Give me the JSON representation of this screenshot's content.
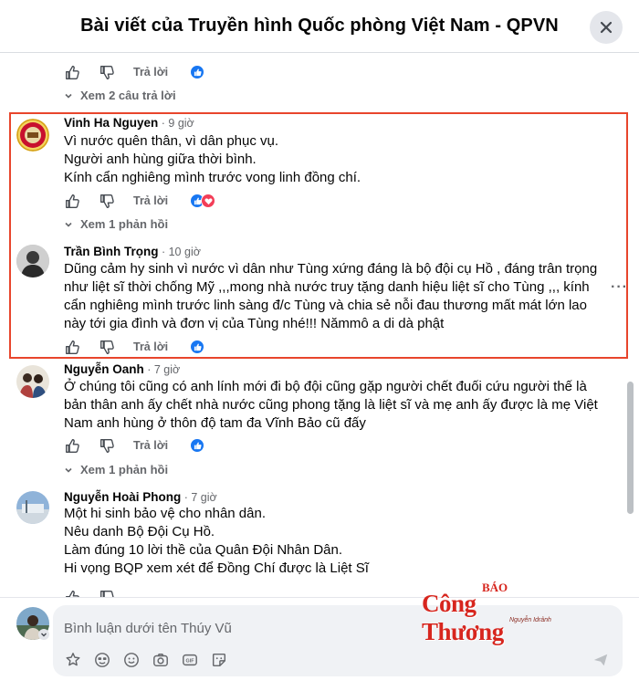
{
  "header": {
    "title": "Bài viết của Truyền hình Quốc phòng Việt Nam - QPVN"
  },
  "top_actions": {
    "reply_label": "Trả lời",
    "view_replies": "Xem 2 câu trả lời"
  },
  "comments": [
    {
      "name": "Vinh Ha Nguyen",
      "time": "9 giờ",
      "lines": [
        "Vì nước quên thân, vì dân phục vụ.",
        "Người anh hùng giữa thời bình.",
        "Kính cẩn nghiêng mình trước vong linh đồng chí."
      ],
      "reply_label": "Trả lời",
      "view_replies": "Xem 1 phản hồi"
    },
    {
      "name": "Trần Bình Trọng",
      "time": "10 giờ",
      "lines": [
        "Dũng cảm hy sinh vì nước vì dân như Tùng xứng đáng là bộ đội cụ Hồ , đáng trân trọng",
        "như liệt sĩ thời chống Mỹ ,,,mong nhà nước truy tặng danh hiệu liệt sĩ cho Tùng ,,, kính",
        "cẩn nghiêng mình trước linh sàng đ/c Tùng và chia sẻ nỗi đau thương mất mát lớn lao",
        "này tới gia đình và đơn vị của Tùng nhé!!! Nămmô a di dà phật"
      ],
      "more": "···",
      "reply_label": "Trả lời"
    },
    {
      "name": "Nguyễn Oanh",
      "time": "7 giờ",
      "lines": [
        "Ở chúng tôi cũng có anh lính mới đi bộ đội cũng gặp người chết đuối cứu người thế là",
        "bản thân anh ấy chết nhà nước cũng phong tặng là liệt sĩ và mẹ anh ấy được là mẹ Việt",
        "Nam anh hùng ở thôn độ tam đa Vĩnh Bảo cũ đấy"
      ],
      "reply_label": "Trả lời",
      "view_replies": "Xem 1 phản hồi"
    },
    {
      "name": "Nguyễn Hoài Phong",
      "time": "7 giờ",
      "lines": [
        "Một hi sinh bảo vệ cho nhân dân.",
        "Nêu danh Bộ Đội Cụ Hồ.",
        "Làm đúng 10 lời thề của Quân Đội Nhân Dân.",
        "Hi vọng BQP xem xét để Đồng Chí được là Liệt Sĩ"
      ]
    }
  ],
  "composer": {
    "placeholder": "Bình luận dưới tên Thúy Vũ"
  },
  "watermark": {
    "top": "BÁO",
    "brand": "Công Thương",
    "sub": "Nguyễn Idrảnh"
  },
  "colors": {
    "accent": "#1877f2",
    "highlight": "#e8452c",
    "watermark": "#d7261e"
  }
}
